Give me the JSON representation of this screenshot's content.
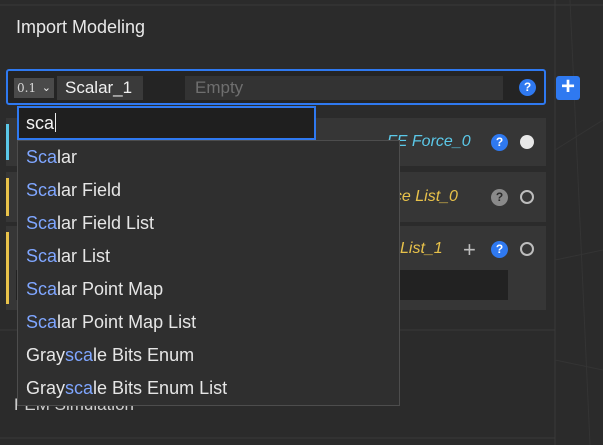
{
  "panel": {
    "title": "Import Modeling"
  },
  "param": {
    "type_badge": "0.1",
    "name": "Scalar_1",
    "value_placeholder": "Empty"
  },
  "nodes": [
    {
      "label": "FE Force_0",
      "accent": "#5bc8e8",
      "label_color": "#5bc8e8"
    },
    {
      "label": "ace List_0",
      "accent": "#e8c24a",
      "label_color": "#e8c24a"
    },
    {
      "label": "List_1",
      "accent": "#e8c24a",
      "label_color": "#e8c24a"
    }
  ],
  "search": {
    "value": "sca"
  },
  "dropdown": {
    "items": [
      {
        "pre": "",
        "match": "Sca",
        "post": "lar"
      },
      {
        "pre": "",
        "match": "Sca",
        "post": "lar Field"
      },
      {
        "pre": "",
        "match": "Sca",
        "post": "lar Field List"
      },
      {
        "pre": "",
        "match": "Sca",
        "post": "lar List"
      },
      {
        "pre": "",
        "match": "Sca",
        "post": "lar Point Map"
      },
      {
        "pre": "",
        "match": "Sca",
        "post": "lar Point Map List"
      },
      {
        "pre": "Gray",
        "match": "sca",
        "post": "le Bits Enum"
      },
      {
        "pre": "Gray",
        "match": "sca",
        "post": "le Bits Enum List"
      }
    ]
  },
  "section": {
    "title": "FEM Simulation"
  },
  "icons": {
    "help": "?",
    "add": "+",
    "chevron": "⌄"
  },
  "colors": {
    "accent": "#2f79f0",
    "match_highlight": "#7fa6ff",
    "cyan_accent": "#5bc8e8",
    "yellow_accent": "#e8c24a"
  }
}
